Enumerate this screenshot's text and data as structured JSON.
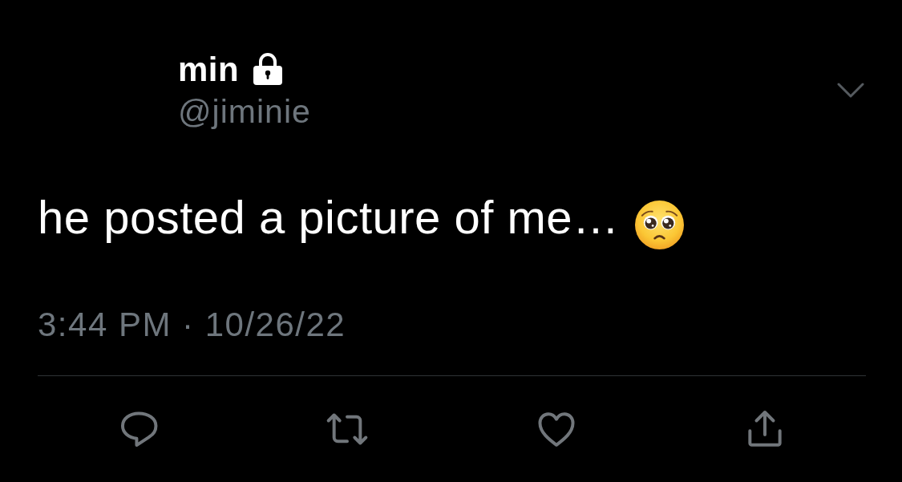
{
  "author": {
    "name": "min",
    "protected": true,
    "handle": "@jiminie"
  },
  "tweet": {
    "text": "he posted a picture of me…"
  },
  "timestamp": "3:44 PM · 10/26/22"
}
